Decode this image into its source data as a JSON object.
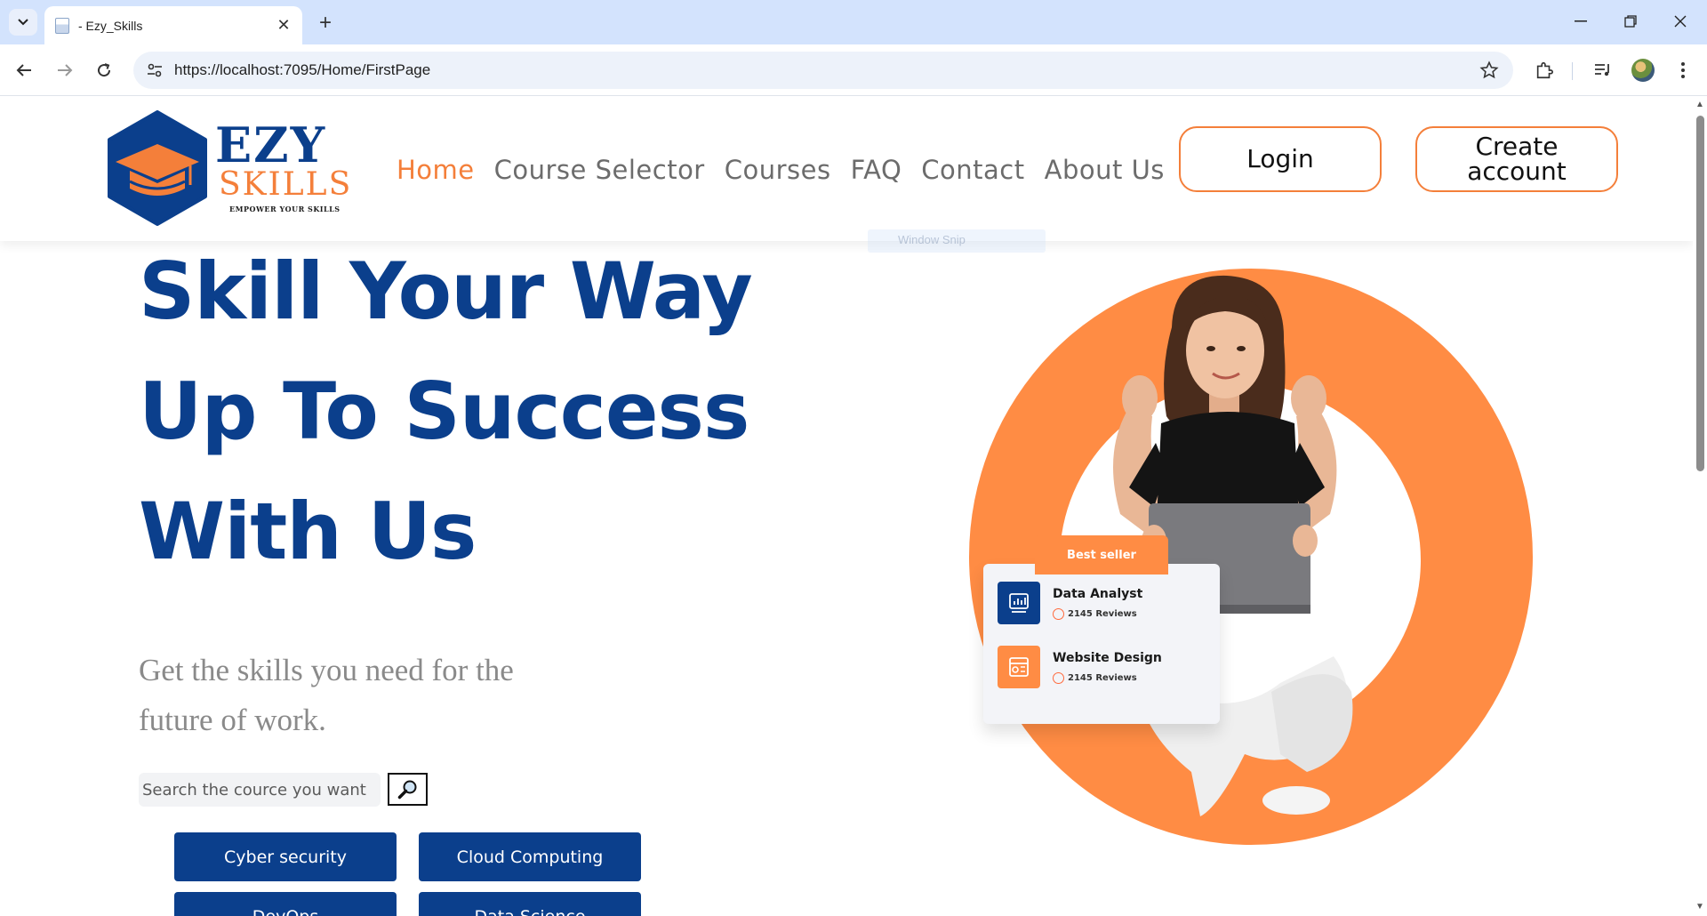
{
  "browser": {
    "tab_title": "- Ezy_Skills",
    "url": "https://localhost:7095/Home/FirstPage",
    "new_tab_symbol": "+",
    "close_tab_symbol": "✕"
  },
  "header": {
    "brand_top": "EZY",
    "brand_bottom": "SKILLS",
    "tagline": "EMPOWER YOUR SKILLS",
    "nav": [
      "Home",
      "Course Selector",
      "Courses",
      "FAQ",
      "Contact",
      "About Us"
    ],
    "active_nav": "Home",
    "login_label": "Login",
    "create_account_label": "Create account"
  },
  "overlay": {
    "snap_hint": "Window Snip"
  },
  "hero": {
    "title_lines": [
      "Skill Your Way",
      "Up To Success",
      "With Us"
    ],
    "subtitle": "Get the skills you need for the future of work.",
    "search_placeholder": "Search the cource you want",
    "course_buttons": [
      "Cyber security",
      "Cloud Computing",
      "DevOps",
      "Data Science"
    ]
  },
  "best_seller": {
    "tag": "Best seller",
    "items": [
      {
        "name": "Data Analyst",
        "reviews": "2145 Reviews",
        "icon": "chart-icon",
        "color": "#0b3f8c"
      },
      {
        "name": "Website Design",
        "reviews": "2145 Reviews",
        "icon": "design-icon",
        "color": "#ff8c44"
      }
    ]
  },
  "colors": {
    "brand_blue": "#0b3f8c",
    "brand_orange": "#f47f3a",
    "ring_orange": "#ff8c44"
  }
}
